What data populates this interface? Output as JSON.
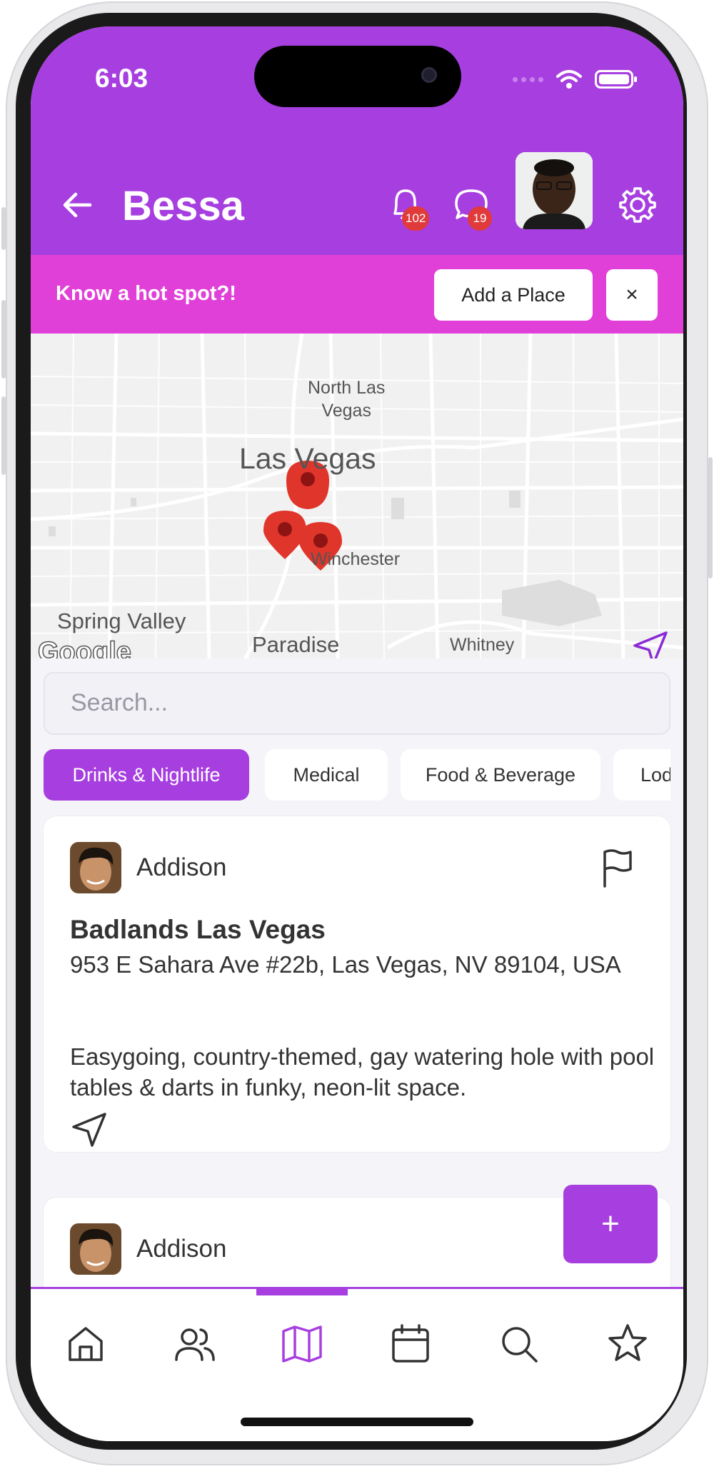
{
  "status_bar": {
    "time": "6:03"
  },
  "header": {
    "back_icon": "arrow-left-icon",
    "title": "Bessa",
    "notifications_count": "102",
    "messages_count": "19"
  },
  "banner": {
    "text": "Know a hot spot?!",
    "add_place_label": "Add a Place",
    "close_label": "×"
  },
  "map": {
    "labels": {
      "north_las_vegas": "North Las\nVegas",
      "las_vegas": "Las Vegas",
      "winchester": "Winchester",
      "spring_valley": "Spring Valley",
      "paradise": "Paradise",
      "whitney": "Whitney",
      "google": "Google"
    },
    "pin_color": "#e0352b"
  },
  "search": {
    "placeholder": "Search..."
  },
  "categories": [
    "Drinks & Nightlife",
    "Medical",
    "Food & Beverage",
    "Lodging"
  ],
  "posts": [
    {
      "user": "Addison",
      "name": "Badlands Las Vegas",
      "address": "953 E Sahara Ave #22b, Las Vegas, NV 89104, USA",
      "description": "Easygoing, country-themed, gay watering hole with pool tables & darts in funky, neon-lit space."
    },
    {
      "user": "Addison"
    }
  ],
  "fab_label": "+",
  "colors": {
    "accent": "#a73fe0",
    "banner": "#e040d8",
    "badge": "#e03a3a"
  }
}
